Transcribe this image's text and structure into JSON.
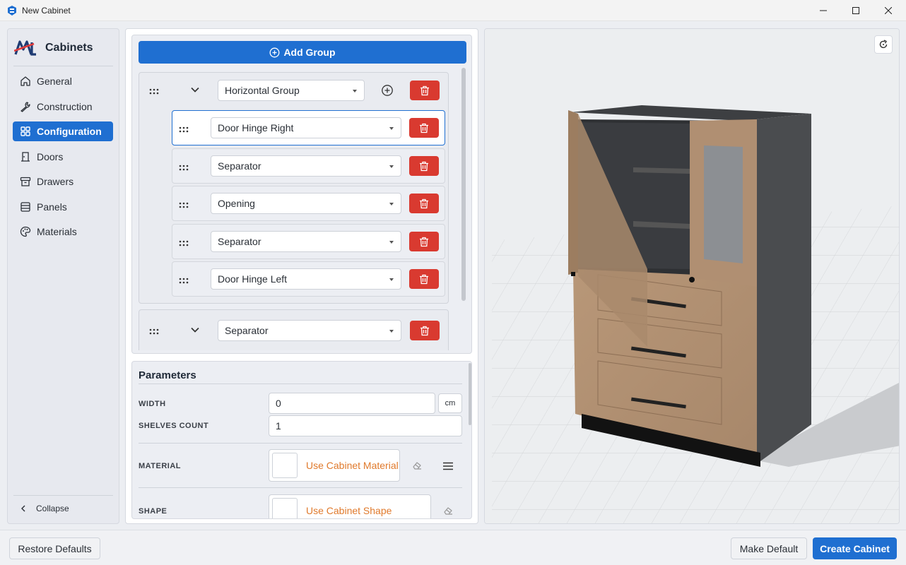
{
  "window": {
    "title": "New Cabinet"
  },
  "sidebar": {
    "brand": "Cabinets",
    "items": [
      {
        "label": "General",
        "icon": "home-icon"
      },
      {
        "label": "Construction",
        "icon": "wrench-icon"
      },
      {
        "label": "Configuration",
        "icon": "grid-icon",
        "active": true
      },
      {
        "label": "Doors",
        "icon": "door-icon"
      },
      {
        "label": "Drawers",
        "icon": "archive-icon"
      },
      {
        "label": "Panels",
        "icon": "panels-icon"
      },
      {
        "label": "Materials",
        "icon": "palette-icon"
      }
    ],
    "collapse": "Collapse"
  },
  "groups": {
    "add_label": "Add Group",
    "group1": {
      "type": "Horizontal Group",
      "children": [
        "Door Hinge Right",
        "Separator",
        "Opening",
        "Separator",
        "Door Hinge Left"
      ]
    },
    "group2": {
      "type": "Separator"
    }
  },
  "parameters": {
    "title": "Parameters",
    "width_label": "WIDTH",
    "width_value": "0",
    "width_unit": "cm",
    "shelves_label": "SHELVES COUNT",
    "shelves_value": "1",
    "material_label": "MATERIAL",
    "material_value": "Use Cabinet Material",
    "shape_label": "SHAPE",
    "shape_value": "Use Cabinet Shape"
  },
  "footer": {
    "restore": "Restore Defaults",
    "make_default": "Make Default",
    "create": "Create Cabinet"
  },
  "colors": {
    "accent": "#1f6fd1",
    "danger": "#d93a30",
    "link": "#e07a2c"
  }
}
